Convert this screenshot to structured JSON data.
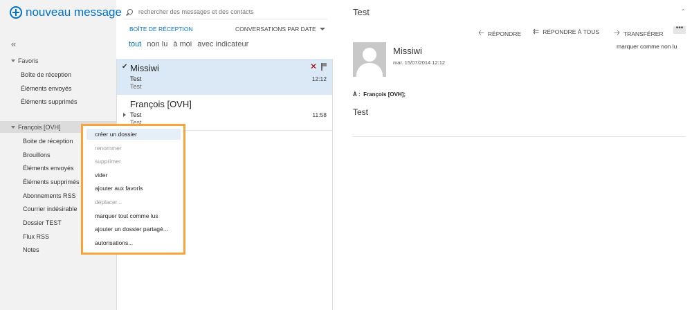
{
  "header": {
    "new_message": "nouveau message",
    "search_placeholder": "rechercher des messages et des contacts"
  },
  "sidebar": {
    "collapse": "«",
    "favorites_title": "Favoris",
    "favorites": [
      "Boîte de réception",
      "Éléments envoyés",
      "Éléments supprimés"
    ],
    "account_title": "François [OVH]",
    "folders": [
      "Boite de réception",
      "Brouillons",
      "Éléments envoyés",
      "Éléments supprimés",
      "Abonnements RSS",
      "Courrier indésirable",
      "Dossier TEST",
      "Flux RSS",
      "Notes"
    ]
  },
  "list": {
    "folder_title": "BOÎTE DE RÉCEPTION",
    "sort": "CONVERSATIONS PAR DATE",
    "filters": [
      "tout",
      "non lu",
      "à moi",
      "avec indicateur"
    ],
    "messages": [
      {
        "sender": "Missiwi",
        "subject": "Test",
        "preview": "Test",
        "time": "12:12"
      },
      {
        "sender": "François [OVH]",
        "subject": "Test",
        "preview": "Test",
        "time": "11:58"
      }
    ]
  },
  "context_menu": {
    "items": [
      {
        "label": "créer un dossier",
        "enabled": true
      },
      {
        "label": "renommer",
        "enabled": false
      },
      {
        "label": "supprimer",
        "enabled": false
      },
      {
        "label": "vider",
        "enabled": true
      },
      {
        "label": "ajouter aux favoris",
        "enabled": true
      },
      {
        "label": "déplacer...",
        "enabled": false
      },
      {
        "label": "marquer tout comme lus",
        "enabled": true
      },
      {
        "label": "ajouter un dossier partagé...",
        "enabled": true
      },
      {
        "label": "autorisations...",
        "enabled": true
      }
    ],
    "highlight_color": "#f7a43b"
  },
  "reading": {
    "title": "Test",
    "actions": {
      "reply": "RÉPONDRE",
      "reply_all": "RÉPONDRE À TOUS",
      "forward": "TRANSFÉRER",
      "more": "•••"
    },
    "mark_unread": "marquer comme non lu",
    "sender": "Missiwi",
    "date": "mar. 15/07/2014 12:12",
    "to_label": "À :",
    "to": "François [OVH];",
    "body": "Test"
  },
  "colors": {
    "accent": "#0072c6",
    "selected_row": "#dbe9f7",
    "sidebar_bg": "#f2f2f2"
  }
}
